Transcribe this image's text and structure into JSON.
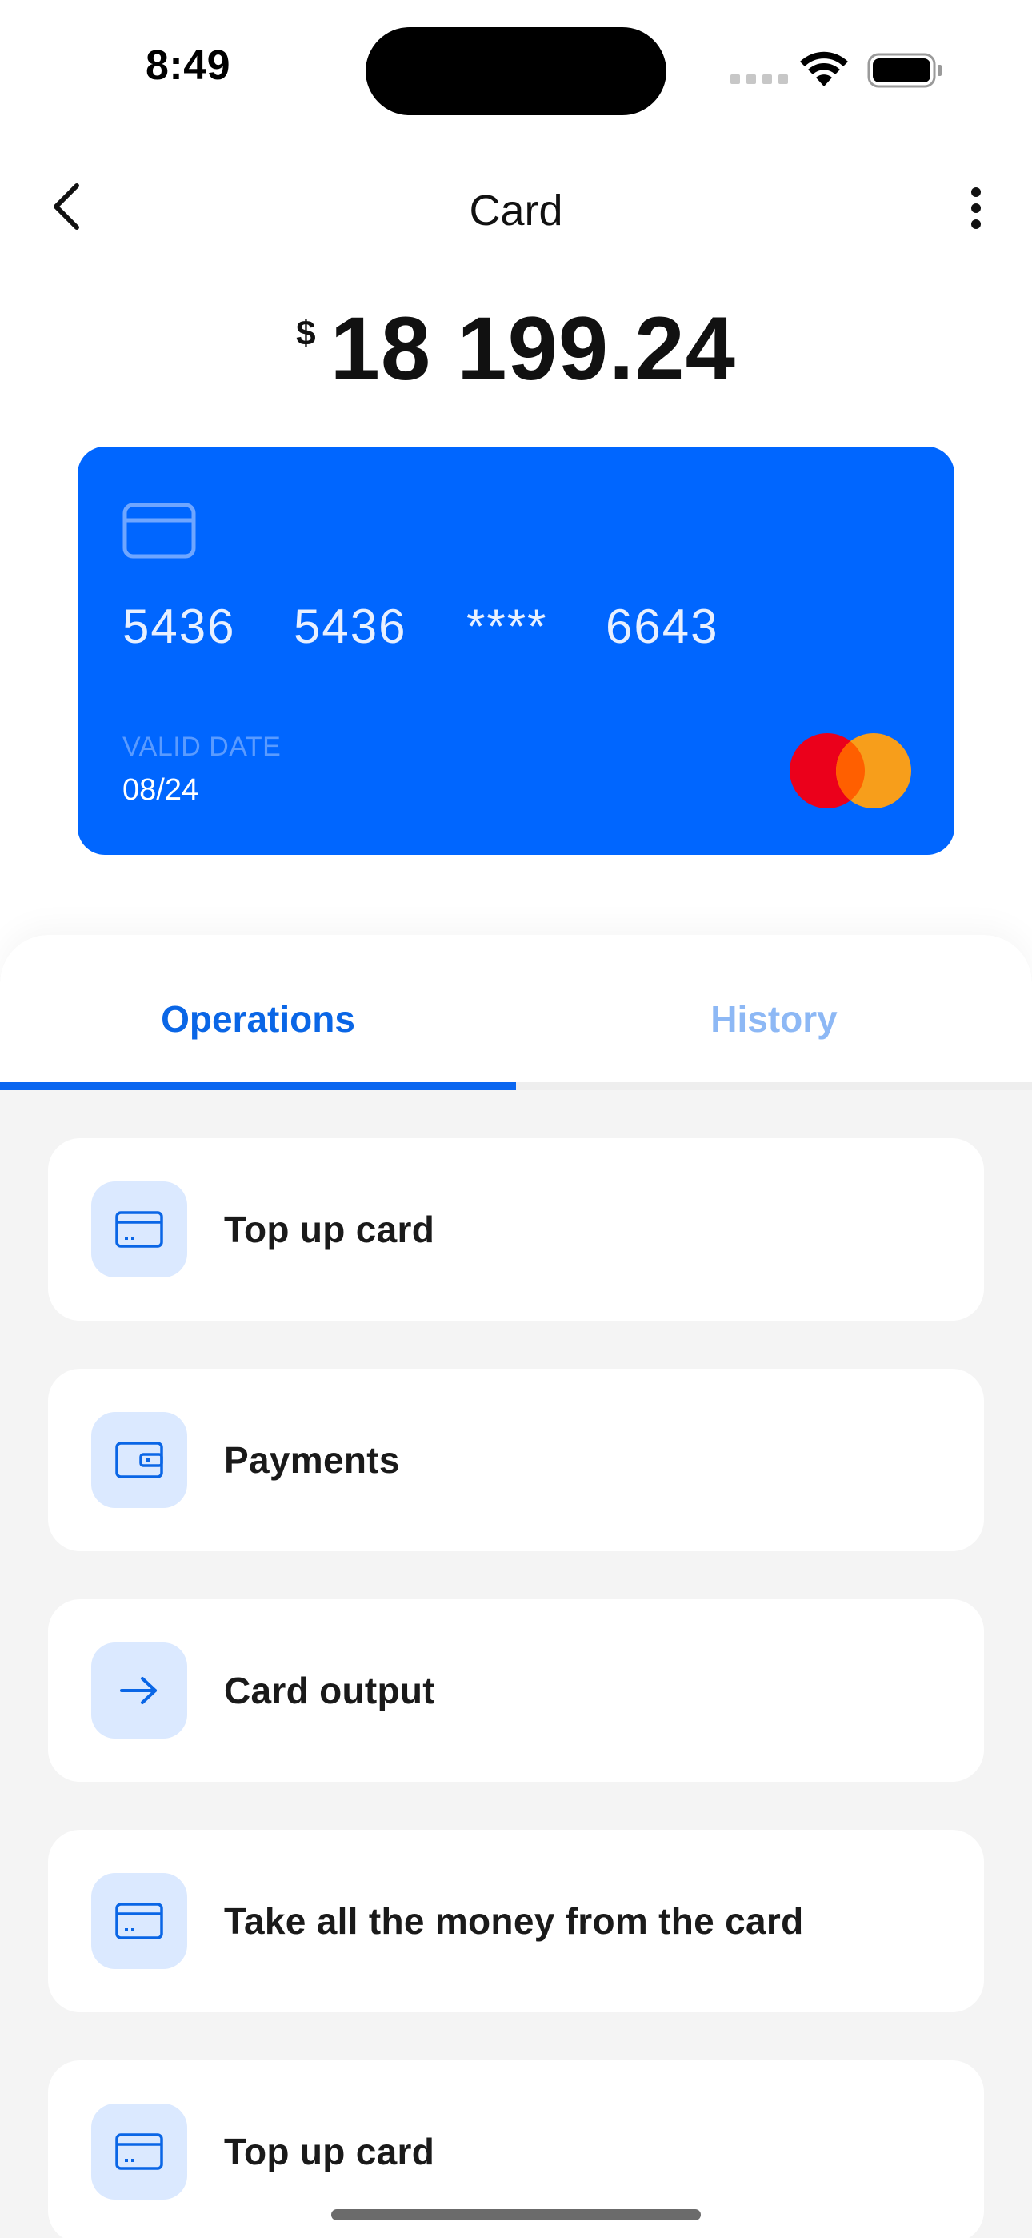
{
  "status_bar": {
    "time": "8:49"
  },
  "header": {
    "title": "Card"
  },
  "balance": {
    "currency": "$",
    "amount": "18 199.24"
  },
  "card": {
    "number_groups": [
      "5436",
      "5436",
      "****",
      "6643"
    ],
    "valid_label": "VALID DATE",
    "valid_date": "08/24",
    "brand_icon": "mastercard-logo",
    "colors": {
      "background": "#0066ff",
      "mc_red": "#eb001b",
      "mc_orange": "#f79e1b"
    }
  },
  "tabs": [
    {
      "label": "Operations",
      "active": true
    },
    {
      "label": "History",
      "active": false
    }
  ],
  "operations": [
    {
      "label": "Top up card",
      "icon": "credit-card-icon"
    },
    {
      "label": "Payments",
      "icon": "wallet-icon"
    },
    {
      "label": "Card output",
      "icon": "arrow-right-icon"
    },
    {
      "label": "Take all the money from the card",
      "icon": "credit-card-icon"
    },
    {
      "label": "Top up card",
      "icon": "credit-card-icon"
    }
  ],
  "theme": {
    "accent": "#0a66e6",
    "accent_light": "#dbe9ff",
    "inactive_tab": "#8db8f5"
  }
}
